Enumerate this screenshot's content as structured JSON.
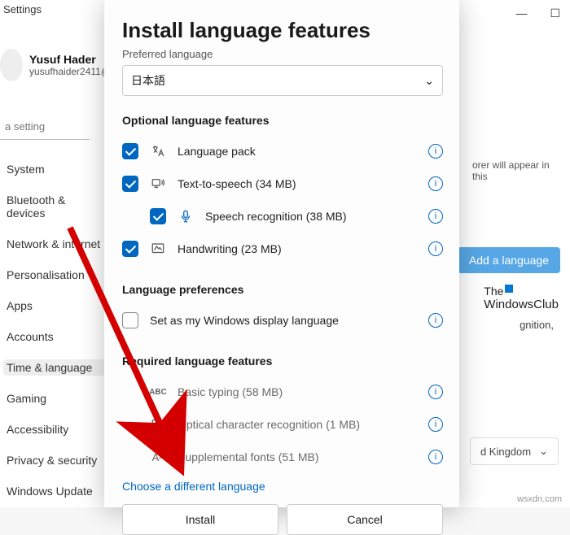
{
  "top": {
    "title": "Settings"
  },
  "user": {
    "name": "Yusuf Hader",
    "email": "yusufhaider2411@"
  },
  "search": {
    "placeholder": "a setting"
  },
  "nav": {
    "items": [
      "System",
      "Bluetooth & devices",
      "Network & internet",
      "Personalisation",
      "Apps",
      "Accounts",
      "Time & language",
      "Gaming",
      "Accessibility",
      "Privacy & security",
      "Windows Update"
    ],
    "selected": 6
  },
  "bg": {
    "hint": "orer will appear in this",
    "addlang": "Add a language",
    "wc1": "The",
    "wc2": "WindowsClub",
    "gn": "gnition,",
    "country": "d Kingdom",
    "brand": "wsxdn.com"
  },
  "dialog": {
    "title": "Install language features",
    "pref_label": "Preferred language",
    "pref_value": "日本語",
    "opt_header": "Optional language features",
    "opts": [
      {
        "label": "Language pack"
      },
      {
        "label": "Text-to-speech (34 MB)"
      },
      {
        "label": "Speech recognition (38 MB)"
      },
      {
        "label": "Handwriting (23 MB)"
      }
    ],
    "prefs_header": "Language preferences",
    "prefs_item": "Set as my Windows display language",
    "req_header": "Required language features",
    "reqs": [
      {
        "label": "Basic typing (58 MB)"
      },
      {
        "label": "Optical character recognition (1 MB)"
      },
      {
        "label": "Supplemental fonts (51 MB)"
      }
    ],
    "link": "Choose a different language",
    "install": "Install",
    "cancel": "Cancel"
  }
}
